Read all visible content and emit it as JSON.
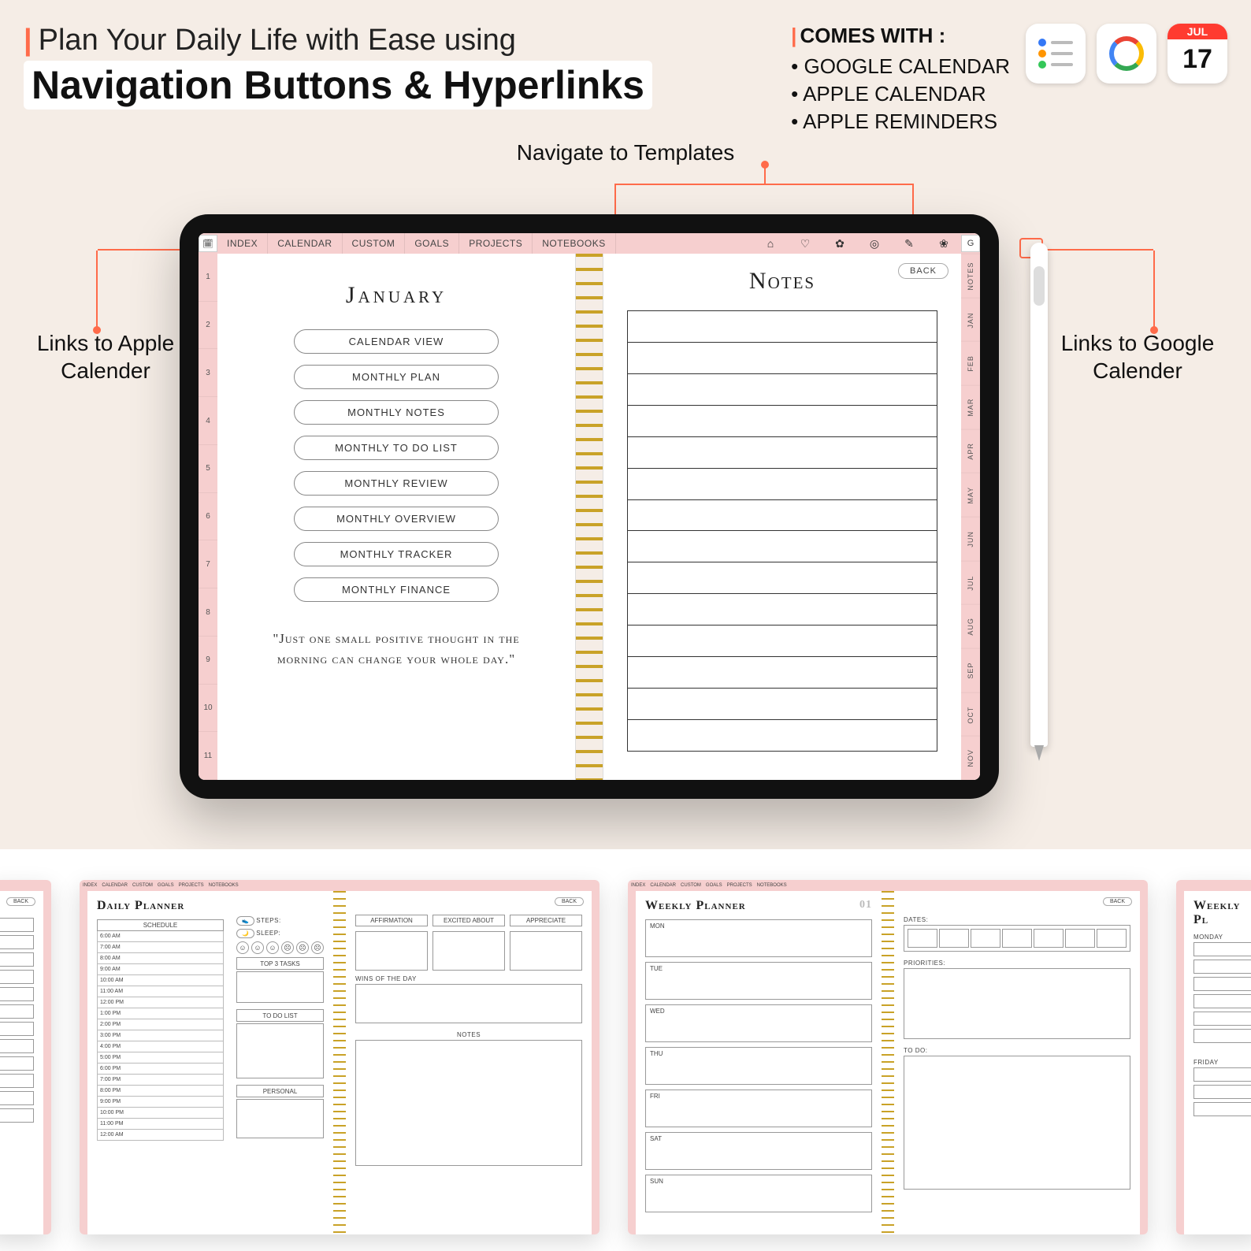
{
  "header": {
    "title_line1": "Plan Your Daily Life with Ease using",
    "title_line2": "Navigation Buttons & Hyperlinks",
    "comes_with_heading": "COMES WITH :",
    "comes_with_items": [
      "GOOGLE CALENDAR",
      "APPLE CALENDAR",
      "APPLE REMINDERS"
    ],
    "apple_cal_month": "JUL",
    "apple_cal_day": "17"
  },
  "annotations": {
    "templates": "Navigate to Templates",
    "left": "Links to Apple Calender",
    "right": "Links to Google Calender"
  },
  "planner": {
    "tabs": [
      "INDEX",
      "CALENDAR",
      "CUSTOM",
      "GOALS",
      "PROJECTS",
      "NOTEBOOKS"
    ],
    "template_icons": [
      "finance-icon",
      "health-icon",
      "wellness-icon",
      "target-icon",
      "study-icon",
      "flower-icon"
    ],
    "left_numbers": [
      "1",
      "2",
      "3",
      "4",
      "5",
      "6",
      "7",
      "8",
      "9",
      "10",
      "11"
    ],
    "right_months": [
      "NOTES",
      "JAN",
      "FEB",
      "MAR",
      "APR",
      "MAY",
      "JUN",
      "JUL",
      "AUG",
      "SEP",
      "OCT",
      "NOV"
    ],
    "month": "January",
    "nav_buttons": [
      "CALENDAR VIEW",
      "MONTHLY PLAN",
      "MONTHLY NOTES",
      "MONTHLY TO DO LIST",
      "MONTHLY REVIEW",
      "MONTHLY OVERVIEW",
      "MONTHLY TRACKER",
      "MONTHLY FINANCE"
    ],
    "quote": "\"Just one small positive thought in the morning can change your whole day.\"",
    "notes_title": "Notes",
    "back_label": "BACK",
    "notes_tab": "NOTES"
  },
  "thumbs": {
    "tabs": [
      "INDEX",
      "CALENDAR",
      "CUSTOM",
      "GOALS",
      "PROJECTS",
      "NOTEBOOKS"
    ],
    "back": "BACK",
    "daily": {
      "title": "Daily Planner",
      "schedule_label": "SCHEDULE",
      "hours": [
        "6:00 AM",
        "7:00 AM",
        "8:00 AM",
        "9:00 AM",
        "10:00 AM",
        "11:00 AM",
        "12:00 PM",
        "1:00 PM",
        "2:00 PM",
        "3:00 PM",
        "4:00 PM",
        "5:00 PM",
        "6:00 PM",
        "7:00 PM",
        "8:00 PM",
        "9:00 PM",
        "10:00 PM",
        "11:00 PM",
        "12:00 AM"
      ],
      "steps": "STEPS:",
      "sleep": "SLEEP:",
      "top3": "TOP 3 TASKS",
      "todo": "TO DO LIST",
      "personal": "PERSONAL",
      "affirmation": "AFFIRMATION",
      "excited": "EXCITED ABOUT",
      "appreciate": "APPRECIATE",
      "wins": "WINS OF THE DAY",
      "notes": "NOTES"
    },
    "weekly": {
      "title": "Weekly Planner",
      "week_num": "01",
      "days": [
        "MON",
        "TUE",
        "WED",
        "THU",
        "FRI",
        "SAT",
        "SUN"
      ],
      "dates": "DATES:",
      "priorities": "PRIORITIES:",
      "todo": "TO DO:"
    },
    "weekly2": {
      "title": "Weekly Pl",
      "monday": "MONDAY",
      "friday": "FRIDAY"
    }
  }
}
